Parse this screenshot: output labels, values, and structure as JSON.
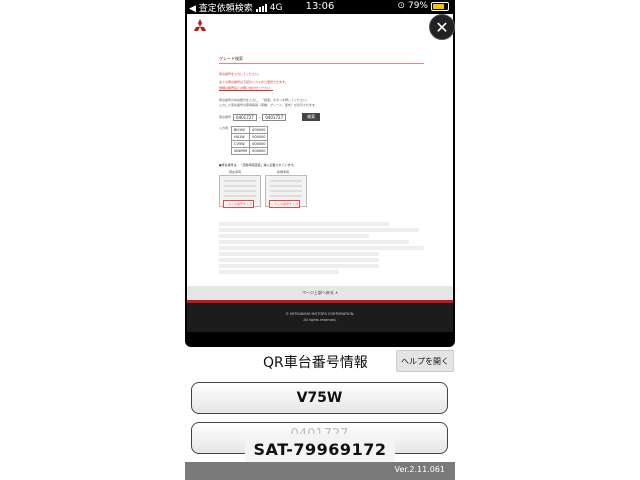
{
  "status_bar": {
    "back_app": "◀ 査定依頼検索",
    "network": "4G",
    "time": "13:06",
    "battery": "79%",
    "battery_level": 0.79
  },
  "webpage": {
    "heading": "グレード検索",
    "notice_line1": "車台番号を入力してください。",
    "notice_line2": "全ての車台番号は下記のリストから選択できます。",
    "notice_line3": "詳細は販売店にお問い合わせください。",
    "instruction1": "車台番号の中央部分を入力し、「検索」ボタンを押してください。",
    "instruction2": "入力した車台番号の車両情報（車種、グレード、型式）が表示されます。",
    "frame_label": "車台番号",
    "frame_prefix": "0401727",
    "frame_value": "0401727",
    "search_button": "検索",
    "result_label": "入力例",
    "result_rows": [
      {
        "code": "BH1W",
        "num": "000000"
      },
      {
        "code": "HA1W",
        "num": "000000"
      },
      {
        "code": "CV5W",
        "num": "000000"
      },
      {
        "code": "SKW9M",
        "num": "000000"
      }
    ],
    "sample_caption": "●車台番号は、「自動車検査証」等に記載されています。",
    "sample_left_title": "現在車両",
    "sample_right_title": "新規車両",
    "sample_red_label": "こちらの番号を入力",
    "backtop": "ページ上部へ戻る ∧",
    "copyright": "© MITSUBISHI MOTORS CORPORATION.",
    "rights": "All rights reserved."
  },
  "app": {
    "qr_title": "QR車台番号情報",
    "help_button": "ヘルプを開く",
    "model_value": "V75W",
    "frame_number_value": "0401727",
    "overlay_label": "SAT-79969172",
    "version": "Ver.2.11.061"
  }
}
